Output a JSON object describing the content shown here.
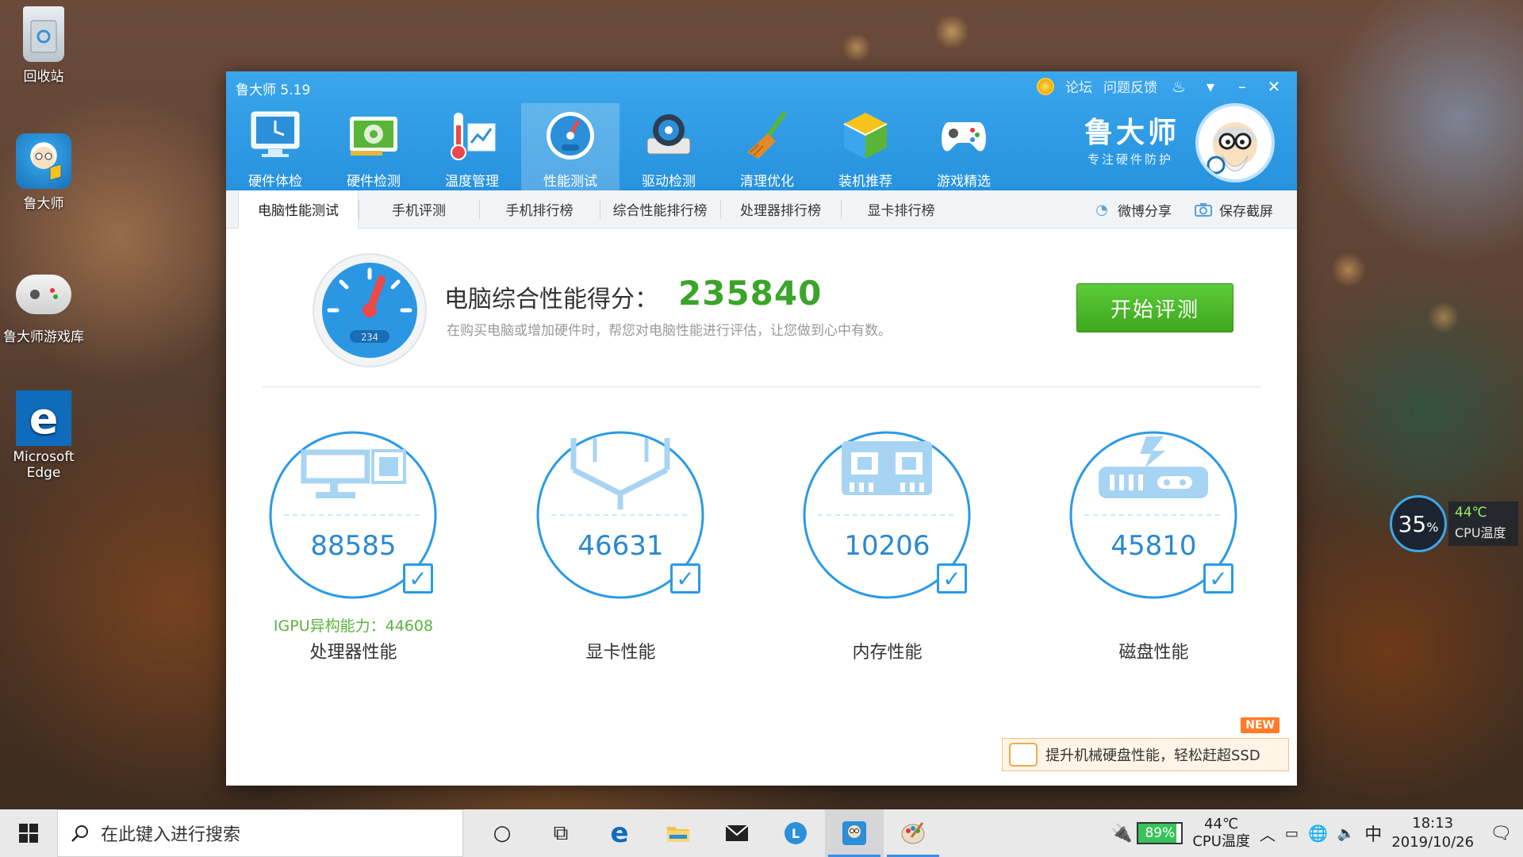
{
  "desktop": {
    "icons": [
      {
        "label": "回收站"
      },
      {
        "label": "鲁大师"
      },
      {
        "label": "鲁大师游戏库"
      },
      {
        "label": "Microsoft Edge"
      }
    ]
  },
  "app": {
    "title": "鲁大师 5.19",
    "title_links": {
      "forum": "论坛",
      "feedback": "问题反馈"
    },
    "toolbar": [
      {
        "label": "硬件体检",
        "icon": "monitor-icon"
      },
      {
        "label": "硬件检测",
        "icon": "graphics-card-icon"
      },
      {
        "label": "温度管理",
        "icon": "thermometer-icon"
      },
      {
        "label": "性能测试",
        "icon": "speedometer-icon",
        "active": true
      },
      {
        "label": "驱动检测",
        "icon": "gear-chip-icon"
      },
      {
        "label": "清理优化",
        "icon": "broom-icon"
      },
      {
        "label": "装机推荐",
        "icon": "cube-icon"
      },
      {
        "label": "游戏精选",
        "icon": "gamepad-icon"
      }
    ],
    "brand": {
      "name": "鲁大师",
      "slogan": "专注硬件防护"
    },
    "subtabs": [
      {
        "label": "电脑性能测试",
        "active": true
      },
      {
        "label": "手机评测"
      },
      {
        "label": "手机排行榜"
      },
      {
        "label": "综合性能排行榜"
      },
      {
        "label": "处理器排行榜"
      },
      {
        "label": "显卡排行榜"
      }
    ],
    "sub_actions": {
      "weibo_share": "微博分享",
      "save_screenshot": "保存截屏"
    },
    "score": {
      "label": "电脑综合性能得分：",
      "value": "235840",
      "description": "在购买电脑或增加硬件时，帮您对电脑性能进行评估，让您做到心中有数。",
      "gauge_text": "234"
    },
    "start_button": "开始评测",
    "metrics": [
      {
        "name": "处理器性能",
        "value": "88585",
        "icon": "cpu-monitor-icon",
        "sub": "IGPU异构能力：44608"
      },
      {
        "name": "显卡性能",
        "value": "46631",
        "icon": "cube-outline-icon"
      },
      {
        "name": "内存性能",
        "value": "10206",
        "icon": "memory-chip-icon"
      },
      {
        "name": "磁盘性能",
        "value": "45810",
        "icon": "hard-disk-icon"
      }
    ],
    "promo": {
      "text": "提升机械硬盘性能，轻松赶超SSD",
      "badge": "NEW"
    }
  },
  "cpu_widget": {
    "percent": "35",
    "unit": "%",
    "temp": "44℃",
    "label": "CPU温度"
  },
  "taskbar": {
    "search_placeholder": "在此键入进行搜索",
    "battery": "89%",
    "battery_level": 0.89,
    "temp": "44℃",
    "temp_label": "CPU温度",
    "ime": "中",
    "time": "18:13",
    "date": "2019/10/26"
  },
  "colors": {
    "accent": "#2792de",
    "score_green": "#3ba42a",
    "button_green": "#4ab82a",
    "metric_blue": "#2a88d0"
  }
}
